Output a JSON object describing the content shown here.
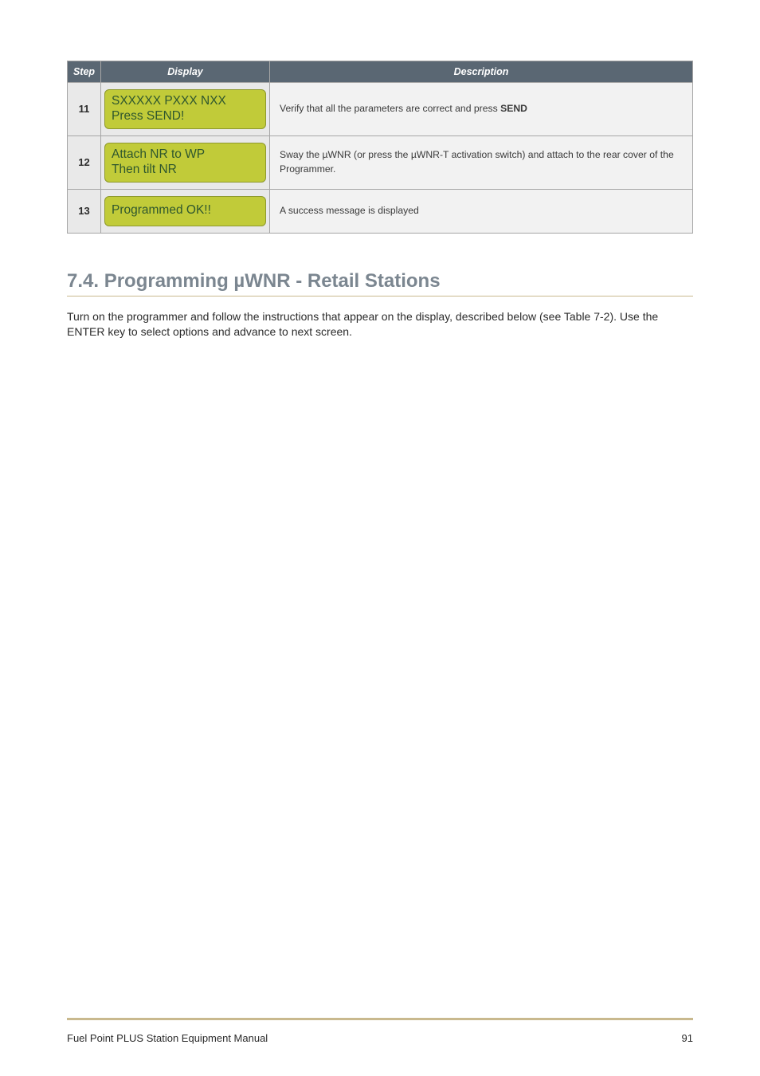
{
  "table": {
    "headers": {
      "step": "Step",
      "display": "Display",
      "description": "Description"
    },
    "rows": [
      {
        "step": "11",
        "display_lines": [
          "SXXXXX PXXX NXX",
          "Press SEND!"
        ],
        "desc_pre": "Verify that all the parameters are correct and press ",
        "desc_bold": "SEND"
      },
      {
        "step": "12",
        "display_lines": [
          "Attach NR to WP",
          "Then tilt NR"
        ],
        "desc": "Sway the µWNR (or press the µWNR-T activation switch) and attach to the rear cover of the Programmer."
      },
      {
        "step": "13",
        "display_lines": [
          "Programmed OK!!"
        ],
        "desc": "A success message is displayed"
      }
    ]
  },
  "section": {
    "number": "7.4.",
    "title": "Programming µWNR - Retail Stations",
    "body": "Turn on the programmer and follow the instructions that appear on the display, described below (see Table 7-2). Use the ENTER key to select options and advance to next screen."
  },
  "footer": {
    "left": "Fuel Point PLUS Station Equipment Manual",
    "right": "91"
  }
}
